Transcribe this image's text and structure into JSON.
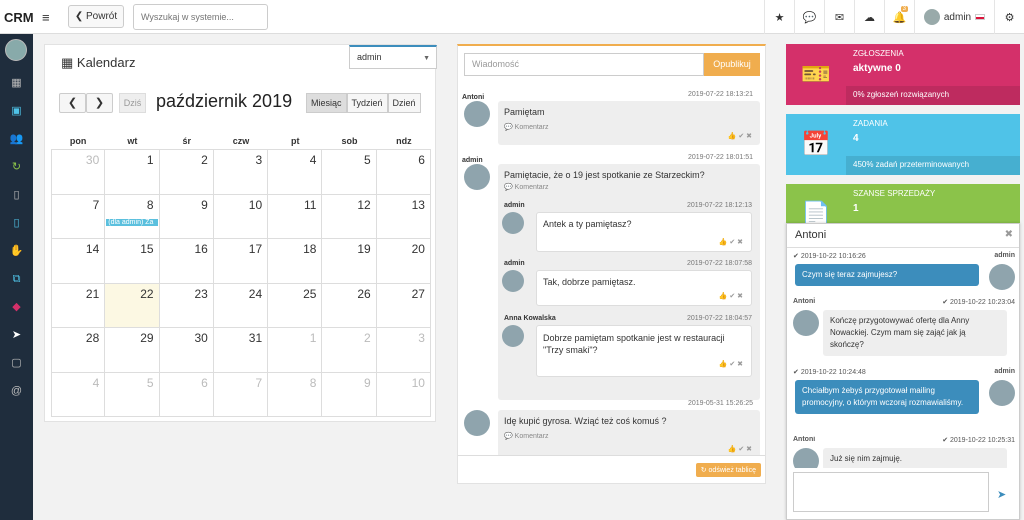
{
  "topbar": {
    "brand": "CRM",
    "back": "❮ Powrót",
    "search_placeholder": "Wyszukaj w systemie...",
    "notif_count": "3",
    "user": "admin"
  },
  "calendar": {
    "title": "Kalendarz",
    "user_select": "admin",
    "today": "Dziś",
    "month": "październik 2019",
    "views": [
      "Miesiąc",
      "Tydzień",
      "Dzień"
    ],
    "dow": [
      "pon",
      "wt",
      "śr",
      "czw",
      "pt",
      "sob",
      "ndz"
    ],
    "weeks": [
      [
        "30",
        "1",
        "2",
        "3",
        "4",
        "5",
        "6"
      ],
      [
        "7",
        "8",
        "9",
        "10",
        "11",
        "12",
        "13"
      ],
      [
        "14",
        "15",
        "16",
        "17",
        "18",
        "19",
        "20"
      ],
      [
        "21",
        "22",
        "23",
        "24",
        "25",
        "26",
        "27"
      ],
      [
        "28",
        "29",
        "30",
        "31",
        "1",
        "2",
        "3"
      ],
      [
        "4",
        "5",
        "6",
        "7",
        "8",
        "9",
        "10"
      ]
    ],
    "event": "(dla admin) Za"
  },
  "feed": {
    "placeholder": "Wiadomość",
    "publish": "Opublikuj",
    "comment": "Komentarz",
    "refresh": "odśwież tablicę",
    "posts": [
      {
        "author": "Antoni",
        "date": "2019-07-22 18:13:21",
        "text": "Pamiętam"
      },
      {
        "author": "admin",
        "date": "2019-07-22 18:01:51",
        "text": "Pamiętacie, że o 19 jest spotkanie ze Starzeckim?",
        "replies": [
          {
            "author": "admin",
            "date": "2019-07-22 18:12:13",
            "text": "Antek a ty pamiętasz?"
          },
          {
            "author": "admin",
            "date": "2019-07-22 18:07:58",
            "text": "Tak, dobrze pamiętasz."
          },
          {
            "author": "Anna Kowalska",
            "date": "2019-07-22 18:04:57",
            "text": "Dobrze pamiętam spotkanie jest w restauracji \"Trzy smaki\"?"
          }
        ]
      },
      {
        "author": "",
        "date": "2019-05-31 15:26:25",
        "text": "Idę kupić gyrosa. Wziąć też coś komuś ?"
      }
    ]
  },
  "stats": [
    {
      "title": "ZGŁOSZENIA",
      "value": "aktywne 0",
      "footer": "0% zgłoszeń rozwiązanych",
      "color": "#d4306a",
      "icon": "ticket-icon"
    },
    {
      "title": "ZADANIA",
      "value": "4",
      "footer": "450% zadań przeterminowanych",
      "color": "#4fc3e8",
      "icon": "calendar-check-icon"
    },
    {
      "title": "SZANSE SPRZEDAŻY",
      "value": "1",
      "footer": "",
      "color": "#8bc34a",
      "icon": "document-icon"
    }
  ],
  "chat": {
    "title": "Antoni",
    "messages": [
      {
        "side": "out",
        "author": "admin",
        "date": "2019-10-22 10:16:26",
        "text": "Czym się teraz zajmujesz?"
      },
      {
        "side": "in",
        "author": "Antoni",
        "date": "2019-10-22 10:23:04",
        "text": "Kończę przygotowywać ofertę dla Anny Nowackiej. Czym mam się zająć jak ją skończę?"
      },
      {
        "side": "out",
        "author": "admin",
        "date": "2019-10-22 10:24:48",
        "text": "Chciałbym żebyś przygotował mailing promocyjny, o którym wczoraj rozmawialiśmy."
      },
      {
        "side": "in",
        "author": "Antoni",
        "date": "2019-10-22 10:25:31",
        "text": "Już się nim zajmuję."
      }
    ]
  }
}
